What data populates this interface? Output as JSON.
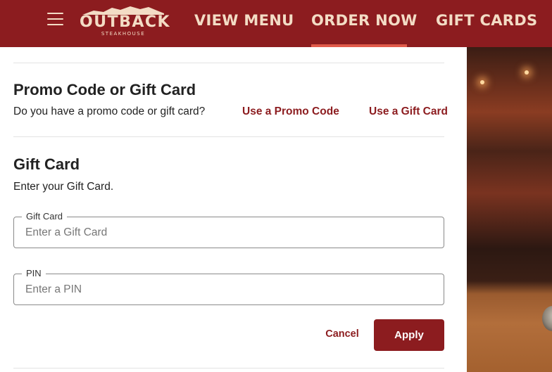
{
  "header": {
    "logo": {
      "name": "OUTBACK",
      "sub": "STEAKHOUSE"
    },
    "nav": [
      {
        "label": "VIEW MENU"
      },
      {
        "label": "ORDER NOW"
      },
      {
        "label": "GIFT CARDS"
      }
    ],
    "active_nav": "ORDER NOW"
  },
  "promo": {
    "title": "Promo Code or Gift Card",
    "question": "Do you have a promo code or gift card?",
    "promo_link": "Use a Promo Code",
    "gift_link": "Use a Gift Card"
  },
  "gift_card": {
    "title": "Gift Card",
    "description": "Enter your Gift Card.",
    "card_field": {
      "label": "Gift Card",
      "placeholder": "Enter a Gift Card",
      "value": ""
    },
    "pin_field": {
      "label": "PIN",
      "placeholder": "Enter a PIN",
      "value": ""
    },
    "cancel_label": "Cancel",
    "apply_label": "Apply"
  },
  "colors": {
    "brand_red": "#8c1c1f",
    "nav_text": "#f3dcc5",
    "active_underline": "#e05a4a"
  }
}
